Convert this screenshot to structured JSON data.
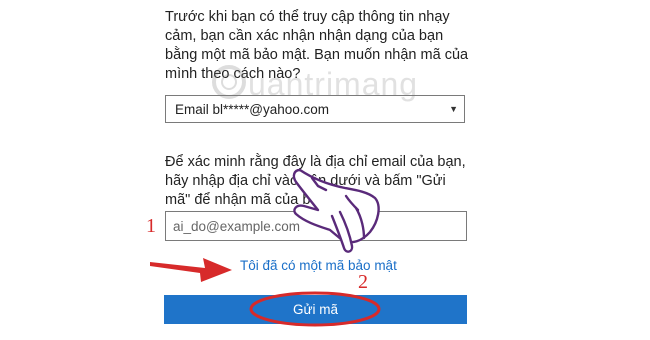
{
  "intro_text": "Trước khi bạn có thể truy cập thông tin nhạy cảm, bạn cần xác nhận nhận dạng của bạn bằng một mã bảo mật. Bạn muốn nhận mã của mình theo cách nào?",
  "method_select": {
    "selected": "Email bl*****@yahoo.com"
  },
  "explain_text": "Để xác minh rằng đây là địa chỉ email của bạn, hãy nhập địa chỉ vào bên dưới và bấm \"Gửi mã\" để nhận mã của bạn.",
  "email_input": {
    "placeholder": "ai_do@example.com",
    "value": ""
  },
  "have_code_link": "Tôi đã có một mã bảo mật",
  "send_button": "Gửi mã",
  "annotations": {
    "step1": "1",
    "step2": "2"
  },
  "watermark": "uantrimang",
  "colors": {
    "button": "#1f74c9",
    "link": "#1a6fc8",
    "annotation": "#d72a2a",
    "hand": "#5a2a7a"
  }
}
